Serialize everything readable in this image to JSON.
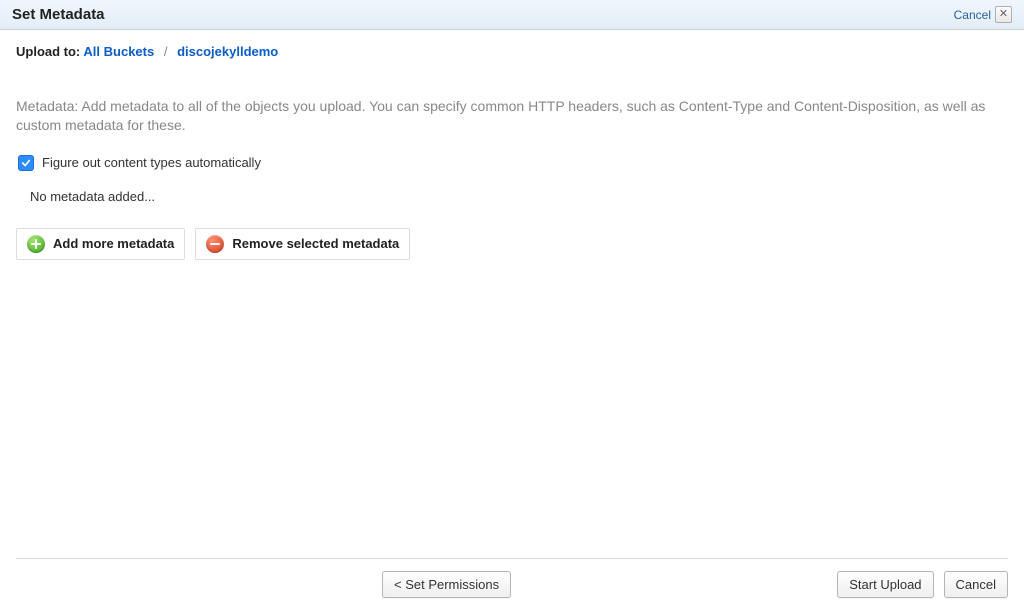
{
  "header": {
    "title": "Set Metadata",
    "cancel_label": "Cancel"
  },
  "breadcrumb": {
    "prefix": "Upload to:",
    "items": [
      "All Buckets",
      "discojekylldemo"
    ]
  },
  "description": "Metadata: Add metadata to all of the objects you upload. You can specify common HTTP headers, such as Content-Type and Content-Disposition, as well as custom metadata for these.",
  "options": {
    "auto_content_type_checked": true,
    "auto_content_type_label": "Figure out content types automatically"
  },
  "metadata_empty_text": "No metadata added...",
  "buttons": {
    "add_metadata": "Add more metadata",
    "remove_metadata": "Remove selected metadata"
  },
  "footer": {
    "back": "< Set Permissions",
    "start_upload": "Start Upload",
    "cancel": "Cancel"
  }
}
